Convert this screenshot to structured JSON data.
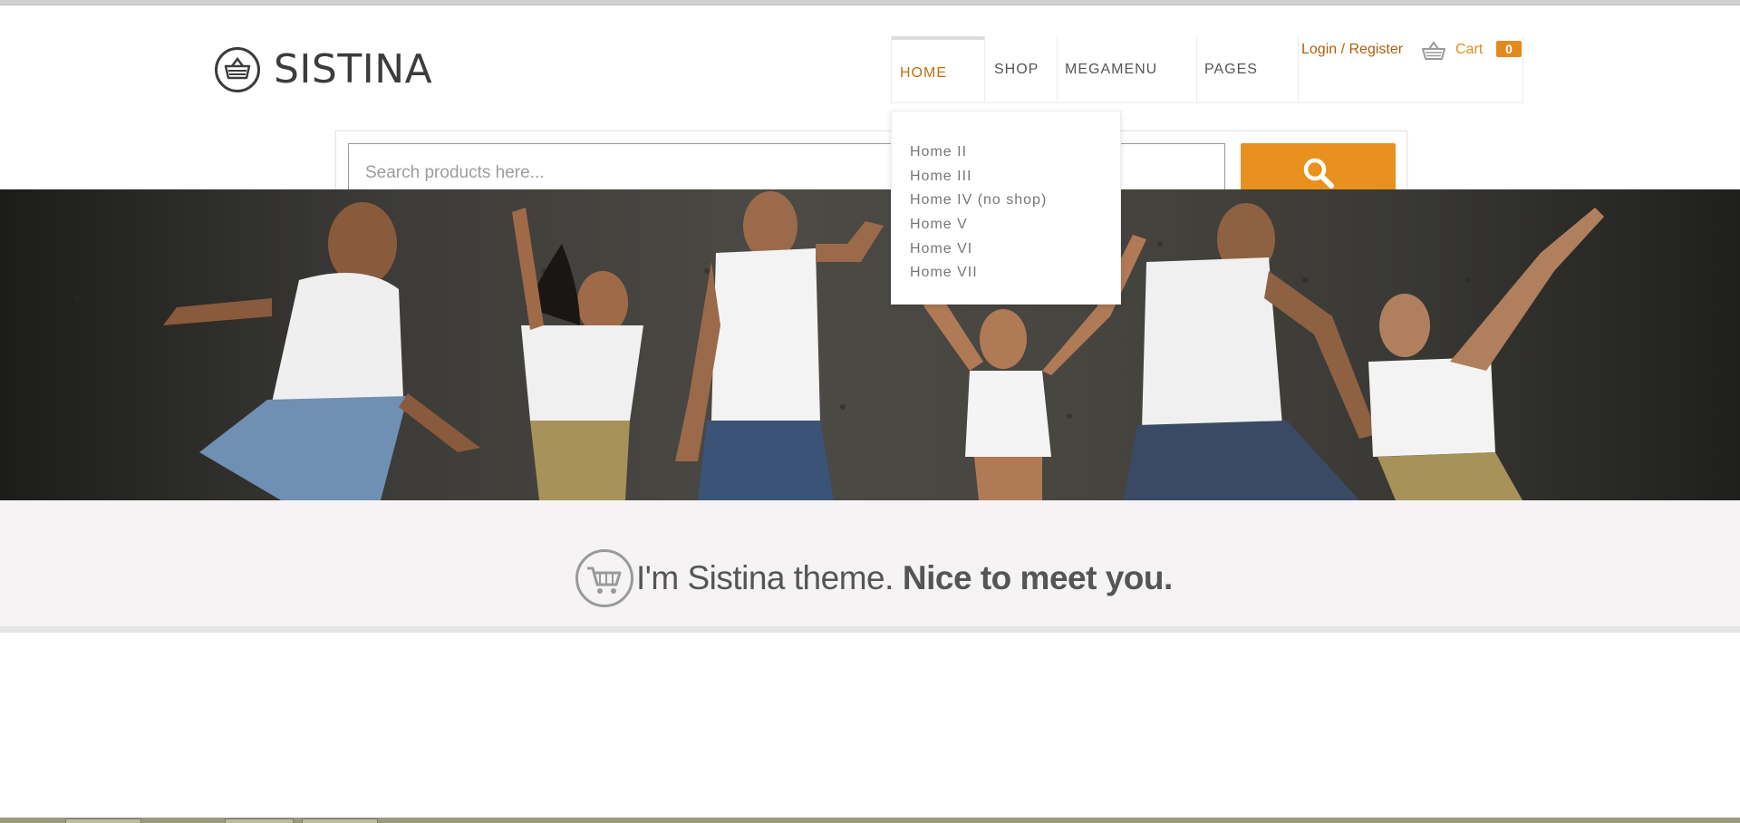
{
  "brand": {
    "name": "SISTINA",
    "icon": "basket-circle-icon"
  },
  "nav": {
    "items": [
      {
        "label": "HOME",
        "active": true
      },
      {
        "label": "SHOP"
      },
      {
        "label": "MEGAMENU"
      },
      {
        "label": "PAGES"
      }
    ],
    "dropdown": [
      "Home II",
      "Home III",
      "Home IV (no shop)",
      "Home V",
      "Home VI",
      "Home VII"
    ]
  },
  "account": {
    "login_label": "Login / Register",
    "cart_label": "Cart",
    "cart_count": "0",
    "cart_icon": "basket-icon"
  },
  "search": {
    "placeholder": "Search products here...",
    "button_icon": "search-icon"
  },
  "welcome": {
    "text": "I'm Sistina theme.",
    "strong": "Nice to meet you.",
    "icon": "cart-circle-icon"
  },
  "colors": {
    "accent": "#e8911f",
    "accent_dark": "#c26e0d",
    "text": "#555555",
    "welcome_bg": "#f5f3f4"
  }
}
